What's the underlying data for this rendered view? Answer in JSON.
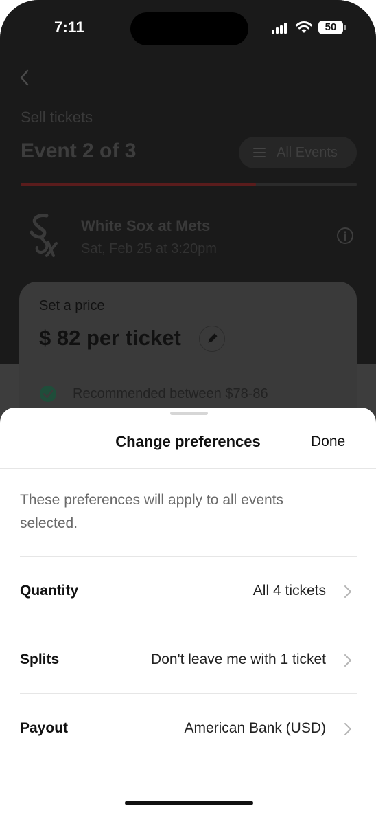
{
  "status_bar": {
    "time": "7:11",
    "battery": "50"
  },
  "background": {
    "subtitle": "Sell tickets",
    "title": "Event 2 of 3",
    "all_events_label": "All Events",
    "progress_fraction": 0.7,
    "event": {
      "name": "White Sox at Mets",
      "date": "Sat, Feb 25 at 3:20pm"
    },
    "price_card": {
      "label": "Set a price",
      "amount": "$ 82 per ticket",
      "recommendation": "Recommended between $78-86"
    }
  },
  "sheet": {
    "title": "Change preferences",
    "done_label": "Done",
    "description": "These preferences will apply to all events selected.",
    "rows": [
      {
        "label": "Quantity",
        "value": "All 4 tickets"
      },
      {
        "label": "Splits",
        "value": "Don't leave me with 1 ticket"
      },
      {
        "label": "Payout",
        "value": "American Bank (USD)"
      }
    ]
  },
  "colors": {
    "accent_red": "#5a1c1c",
    "check_green": "#1f4d3a",
    "overlay": "#1a1a1a"
  }
}
